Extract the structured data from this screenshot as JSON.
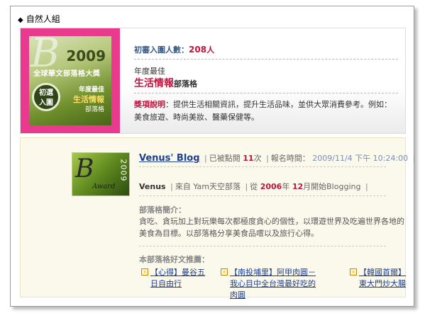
{
  "section": {
    "title": "自然人組"
  },
  "award": {
    "badge": {
      "year": "2009",
      "line1": "全球華文部落格大獎",
      "circle": "初選\n入圍",
      "line2": "年度最佳",
      "line3": "生活情報",
      "line4": "部落格"
    },
    "count_label": "初審入圍人數：",
    "count_value": "208",
    "count_unit": "人",
    "category_label": "年度最佳",
    "category_title": "生活情報",
    "category_suffix": "部落格",
    "desc_key": "獎項說明",
    "desc_text": "：提供生活相關資訊，提升生活品味，並供大眾消費參考。例如：美食旅遊、時尚美妝、醫藥保健等。",
    "colors": {
      "badge_border": "#ea3a8f",
      "accent_red": "#c0143c",
      "count_blue": "#335b8c"
    }
  },
  "blog": {
    "logo": {
      "letters": "B",
      "year": "2009",
      "award": "Award"
    },
    "name": "Venus' Blog",
    "clicked_prefix": "已被點閱",
    "clicked_count": "11",
    "clicked_suffix": "次",
    "signup_label": "報名時間：",
    "signup_time": "2009/11/4 下午 10:24:00",
    "owner": "Venus",
    "from_label": "來自",
    "platform": "Yam天空部落",
    "since_prefix": "從",
    "since_year": "2006",
    "since_year_unit": "年",
    "since_month": "12",
    "since_month_unit": "月開始Blogging",
    "intro_heading": "部落格簡介：",
    "intro_text": "貪吃、貪玩加上對玩樂每次都極度貪心的個性，以環遊世界及吃遍世界各地的美食為目標。以部落格分享美食品嚐以及旅行心得。",
    "rec_heading": "本部落格好文推薦：",
    "recommendations": [
      {
        "title": "【心得】曼谷五日自由行"
      },
      {
        "title": "【南投埔里】阿甲肉圓－我心目中全台灣最好吃的肉圓"
      },
      {
        "title": "【韓國首爾】東大門炒大腸"
      }
    ]
  }
}
